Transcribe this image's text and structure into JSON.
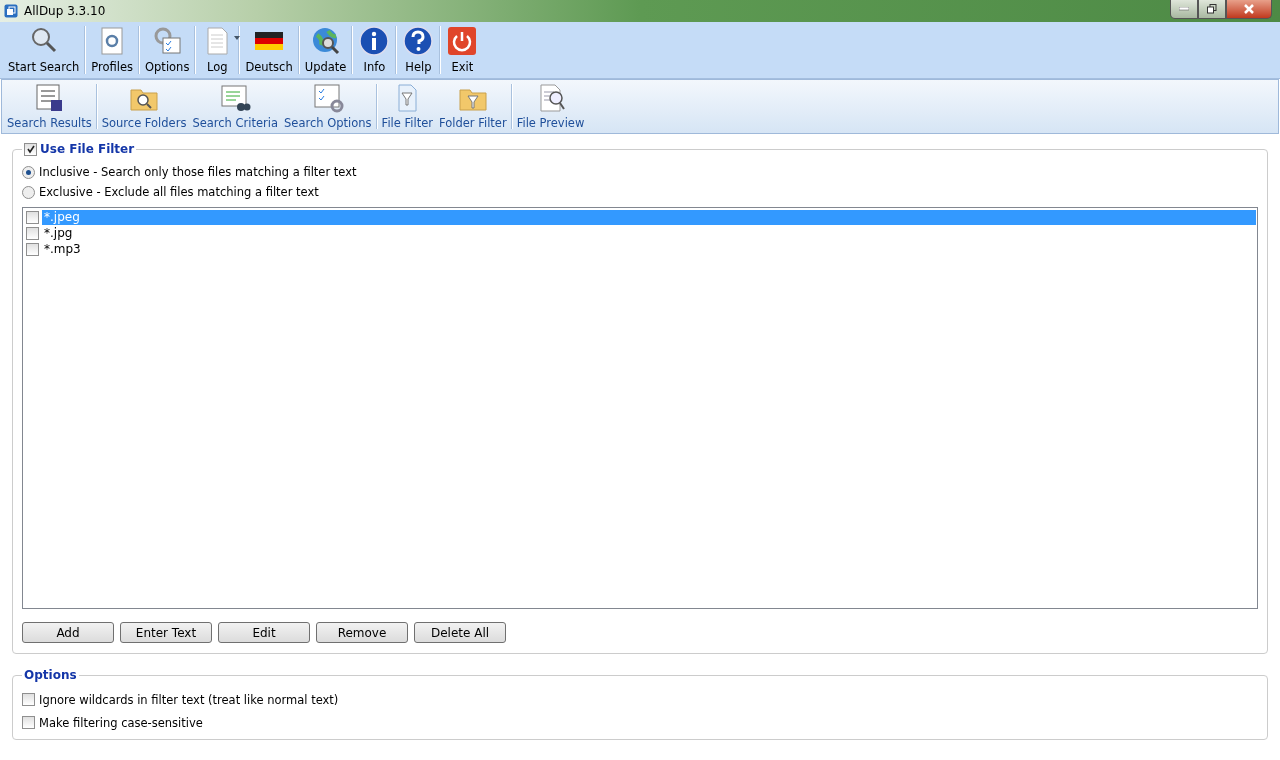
{
  "window": {
    "title": "AllDup 3.3.10"
  },
  "main_toolbar": [
    {
      "label": "Start Search"
    },
    {
      "label": "Profiles"
    },
    {
      "label": "Options"
    },
    {
      "label": "Log",
      "dropdown": true
    },
    {
      "label": "Deutsch"
    },
    {
      "label": "Update"
    },
    {
      "label": "Info"
    },
    {
      "label": "Help"
    },
    {
      "label": "Exit"
    }
  ],
  "section_toolbar": [
    {
      "label": "Search Results"
    },
    {
      "label": "Source Folders"
    },
    {
      "label": "Search Criteria"
    },
    {
      "label": "Search Options"
    },
    {
      "label": "File Filter"
    },
    {
      "label": "Folder Filter"
    },
    {
      "label": "File Preview"
    }
  ],
  "file_filter": {
    "label": "Use File Filter",
    "checked": true,
    "modes": [
      {
        "label": "Inclusive - Search only those files matching a filter text",
        "selected": true
      },
      {
        "label": "Exclusive - Exclude all files matching a filter text",
        "selected": false
      }
    ],
    "filters": [
      {
        "text": "*.jpeg",
        "checked": false,
        "selected": true
      },
      {
        "text": "*.jpg",
        "checked": false,
        "selected": false
      },
      {
        "text": "*.mp3",
        "checked": false,
        "selected": false
      }
    ],
    "buttons": [
      "Add",
      "Enter Text",
      "Edit",
      "Remove",
      "Delete All"
    ]
  },
  "options": {
    "title": "Options",
    "items": [
      {
        "label": "Ignore wildcards in filter text (treat like normal text)",
        "checked": false
      },
      {
        "label": "Make filtering case-sensitive",
        "checked": false
      }
    ]
  }
}
